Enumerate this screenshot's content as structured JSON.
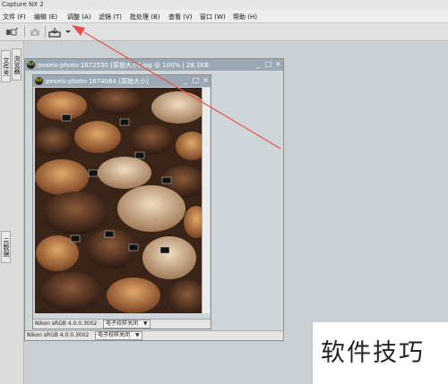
{
  "app": {
    "title": "Capture NX 2"
  },
  "menu": [
    {
      "label": "文件 (F)",
      "name": "menu-file"
    },
    {
      "label": "编辑 (E)",
      "name": "menu-edit"
    },
    {
      "label": "调整 (A)",
      "name": "menu-adjust"
    },
    {
      "label": "滤镜 (T)",
      "name": "menu-filter"
    },
    {
      "label": "批处理 (B)",
      "name": "menu-batch"
    },
    {
      "label": "查看 (V)",
      "name": "menu-view"
    },
    {
      "label": "窗口 (W)",
      "name": "menu-window"
    },
    {
      "label": "帮助 (H)",
      "name": "menu-help"
    }
  ],
  "sidebar": {
    "tab_browser": "文件夹",
    "tab_viewer": "浏览器",
    "tab_metadata": "元数据"
  },
  "back_window": {
    "title": "pexels-photo-1672550 [原始大小].jpg @ 100% | 28.1KB",
    "profile": "Nikon sRGB 4.0.0.3002",
    "softproof": "电子校样关闭"
  },
  "front_window": {
    "title": "pexels-photo-1674064 [原始大小]",
    "profile": "Nikon sRGB 4.0.0.3002",
    "softproof": "电子校样关闭"
  },
  "watermark": {
    "text": "软件技巧"
  },
  "colors": {
    "annotation_arrow": "#e8504a",
    "titlebar": "#9ba8b3"
  }
}
